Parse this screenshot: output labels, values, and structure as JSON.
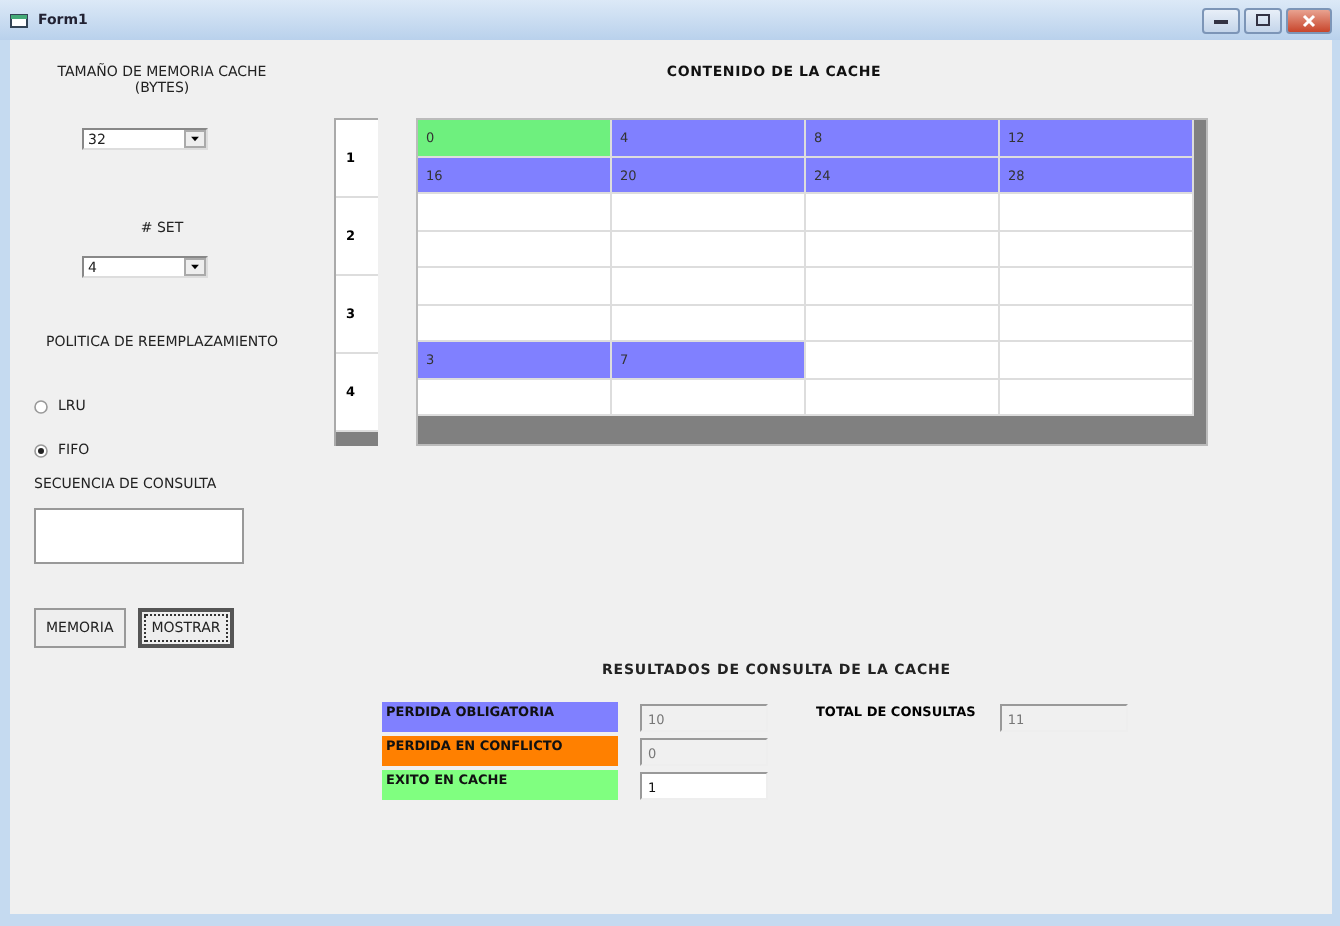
{
  "window": {
    "title": "Form1"
  },
  "settings": {
    "memory_label": "TAMAÑO DE MEMORIA CACHE (BYTES)",
    "memory_value": "32",
    "set_label": "# SET",
    "set_value": "4",
    "policy_label": "POLITICA DE REEMPLAZAMIENTO",
    "policies": [
      {
        "label": "LRU",
        "selected": false
      },
      {
        "label": "FIFO",
        "selected": true
      }
    ],
    "sequence_label": "SECUENCIA DE CONSULTA",
    "buttons": [
      "MEMORIA",
      "MOSTRAR"
    ]
  },
  "cache": {
    "title": "CONTENIDO DE LA CACHE",
    "sets": [
      {
        "label": "1",
        "rows": [
          [
            {
              "text": "0",
              "color": "#6ef07e"
            },
            {
              "text": "4",
              "color": "#8080ff"
            },
            {
              "text": "8",
              "color": "#8080ff"
            },
            {
              "text": "12",
              "color": "#8080ff"
            }
          ],
          [
            {
              "text": "16",
              "color": "#8080ff"
            },
            {
              "text": "20",
              "color": "#8080ff"
            },
            {
              "text": "24",
              "color": "#8080ff"
            },
            {
              "text": "28",
              "color": "#8080ff"
            }
          ]
        ]
      },
      {
        "label": "2",
        "rows": [
          [
            {
              "color": "#ffffff"
            },
            {
              "color": "#ffffff"
            },
            {
              "color": "#ffffff"
            },
            {
              "color": "#ffffff"
            }
          ],
          [
            {
              "color": "#ffffff"
            },
            {
              "color": "#ffffff"
            },
            {
              "color": "#ffffff"
            },
            {
              "color": "#ffffff"
            }
          ]
        ]
      },
      {
        "label": "3",
        "rows": [
          [
            {
              "color": "#ffffff"
            },
            {
              "color": "#ffffff"
            },
            {
              "color": "#ffffff"
            },
            {
              "color": "#ffffff"
            }
          ],
          [
            {
              "color": "#ffffff"
            },
            {
              "color": "#ffffff"
            },
            {
              "color": "#ffffff"
            },
            {
              "color": "#ffffff"
            }
          ]
        ]
      },
      {
        "label": "4",
        "rows": [
          [
            {
              "text": "3",
              "color": "#8080ff"
            },
            {
              "text": "7",
              "color": "#8080ff"
            },
            {
              "color": "#ffffff"
            },
            {
              "color": "#ffffff"
            }
          ],
          [
            {
              "color": "#ffffff"
            },
            {
              "color": "#ffffff"
            },
            {
              "color": "#ffffff"
            },
            {
              "color": "#ffffff"
            }
          ]
        ]
      }
    ]
  },
  "results": {
    "title": "RESULTADOS DE CONSULTA DE LA CACHE",
    "items": [
      {
        "label": "PERDIDA OBLIGATORIA",
        "color": "#8080ff",
        "value": "10",
        "disabled": true
      },
      {
        "label": "PERDIDA EN CONFLICTO",
        "color": "#ff8000",
        "value": "0",
        "disabled": true
      },
      {
        "label": "EXITO EN CACHE",
        "color": "#80ff80",
        "value": "1",
        "disabled": false
      }
    ],
    "total_label": "TOTAL DE CONSULTAS",
    "total_value": "11",
    "total_disabled": true
  }
}
